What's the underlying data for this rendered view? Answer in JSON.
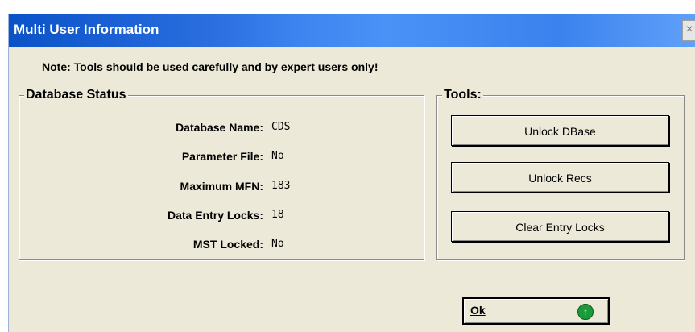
{
  "window": {
    "title": "Multi User Information",
    "close_glyph": "×"
  },
  "note": "Note: Tools should be used carefully and by expert users only!",
  "database_status": {
    "legend": "Database Status",
    "fields": [
      {
        "label": "Database Name:",
        "value": "CDS"
      },
      {
        "label": "Parameter File:",
        "value": "No"
      },
      {
        "label": "Maximum MFN:",
        "value": "183"
      },
      {
        "label": "Data Entry Locks:",
        "value": "18"
      },
      {
        "label": "MST Locked:",
        "value": "No"
      }
    ]
  },
  "tools": {
    "legend": "Tools:",
    "buttons": [
      "Unlock DBase",
      "Unlock Recs",
      "Clear Entry Locks"
    ]
  },
  "ok_button": {
    "label": "Ok",
    "icon": "green-up-arrow-icon"
  }
}
